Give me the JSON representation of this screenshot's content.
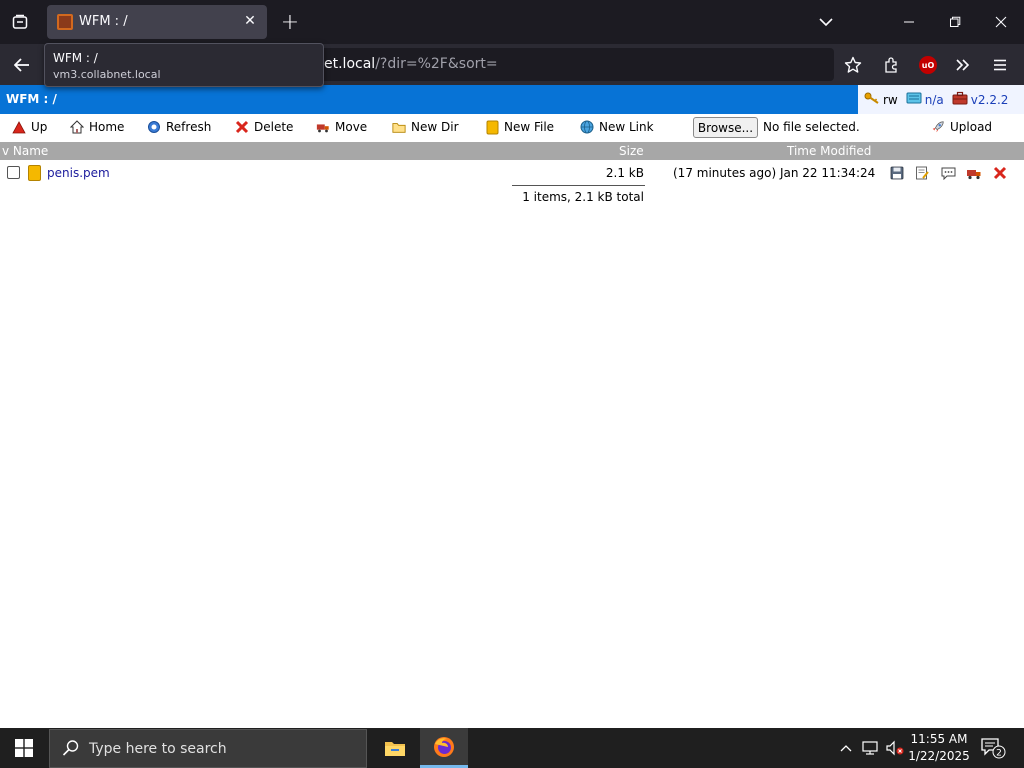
{
  "browser": {
    "tab_title": "WFM : /",
    "url_host": "et.local",
    "url_path": "/?dir=%2F&sort=",
    "tooltip_title": "WFM : /",
    "tooltip_subtitle": "vm3.collabnet.local"
  },
  "wfm": {
    "title": "WFM : /",
    "perm": "rw",
    "quota": "n/a",
    "version": "v2.2.2"
  },
  "toolbar": {
    "up": "Up",
    "home": "Home",
    "refresh": "Refresh",
    "delete": "Delete",
    "move": "Move",
    "new_dir": "New Dir",
    "new_file": "New File",
    "new_link": "New Link",
    "browse": "Browse...",
    "no_file": "No file selected.",
    "upload": "Upload"
  },
  "table": {
    "col_name": "v Name",
    "col_size": "Size",
    "col_time": "Time Modified",
    "rows": [
      {
        "name": "penis.pem",
        "size": "2.1 kB",
        "time": "(17 minutes ago) Jan 22 11:34:24"
      }
    ],
    "summary": "1 items, 2.1 kB total"
  },
  "taskbar": {
    "search_placeholder": "Type here to search",
    "time": "11:55 AM",
    "date": "1/22/2025",
    "notifications": "2"
  },
  "colors": {
    "wfm_header": "#0773d6",
    "table_header": "#a7a7a7",
    "link": "#1a1a9c"
  }
}
